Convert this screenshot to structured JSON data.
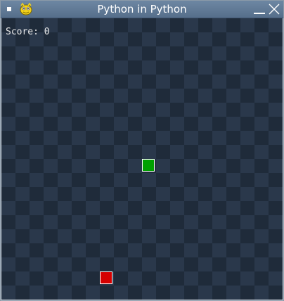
{
  "window": {
    "title": "Python in Python",
    "app_icon": "pygame-snake-icon",
    "menu_icon": "window-menu-icon",
    "minimize_icon": "minimize-icon",
    "close_icon": "close-icon",
    "titlebar_color": "#5f7a97"
  },
  "game": {
    "score_text": "Score: 0",
    "board_colors": {
      "dark": "#1f2b3a",
      "light": "#2a384b"
    },
    "snake": {
      "color": "#00a000",
      "col": 10,
      "row": 10
    },
    "food": {
      "color": "#d40000",
      "col": 7,
      "row": 18
    }
  }
}
